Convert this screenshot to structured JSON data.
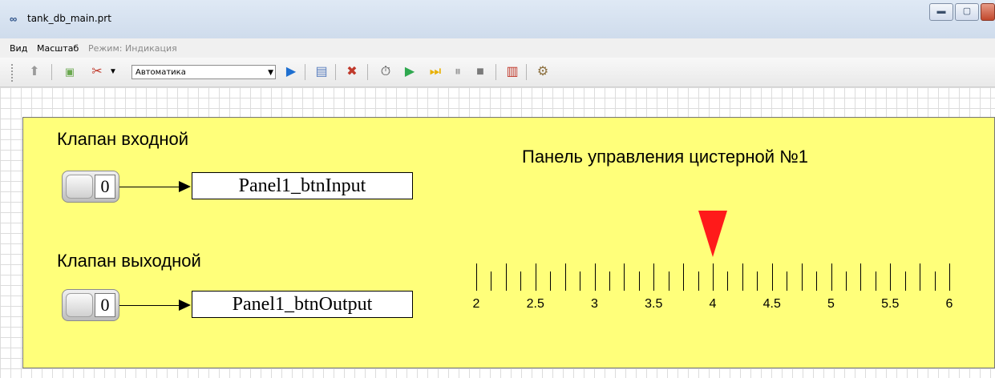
{
  "window": {
    "title": "tank_db_main.prt",
    "icon": "app-icon"
  },
  "menu": {
    "items": [
      "Вид",
      "Масштаб",
      "Режим: Индикация"
    ]
  },
  "toolbar": {
    "mode_select_value": "Автоматика",
    "icons": [
      "up-arrow-icon",
      "script-icon",
      "tools-icon",
      "play-step-icon",
      "layers-icon",
      "disconnect-icon",
      "timer-icon",
      "run-icon",
      "step-forward-icon",
      "pause-icon",
      "stop-icon",
      "chart-icon",
      "settings-icon"
    ]
  },
  "panel": {
    "title": "Панель управления цистерной №1",
    "input_valve": {
      "label": "Клапан входной",
      "value": "0",
      "variable": "Panel1_btnInput"
    },
    "output_valve": {
      "label": "Клапан выходной",
      "value": "0",
      "variable": "Panel1_btnOutput"
    },
    "scale": {
      "min": 2,
      "max": 6,
      "labels": [
        "2",
        "2.5",
        "3",
        "3.5",
        "4",
        "4.5",
        "5",
        "5.5",
        "6"
      ],
      "pointer_value": 4,
      "pointer_color": "#ff1a1a"
    }
  },
  "colors": {
    "panel_background": "#ffff7a"
  }
}
